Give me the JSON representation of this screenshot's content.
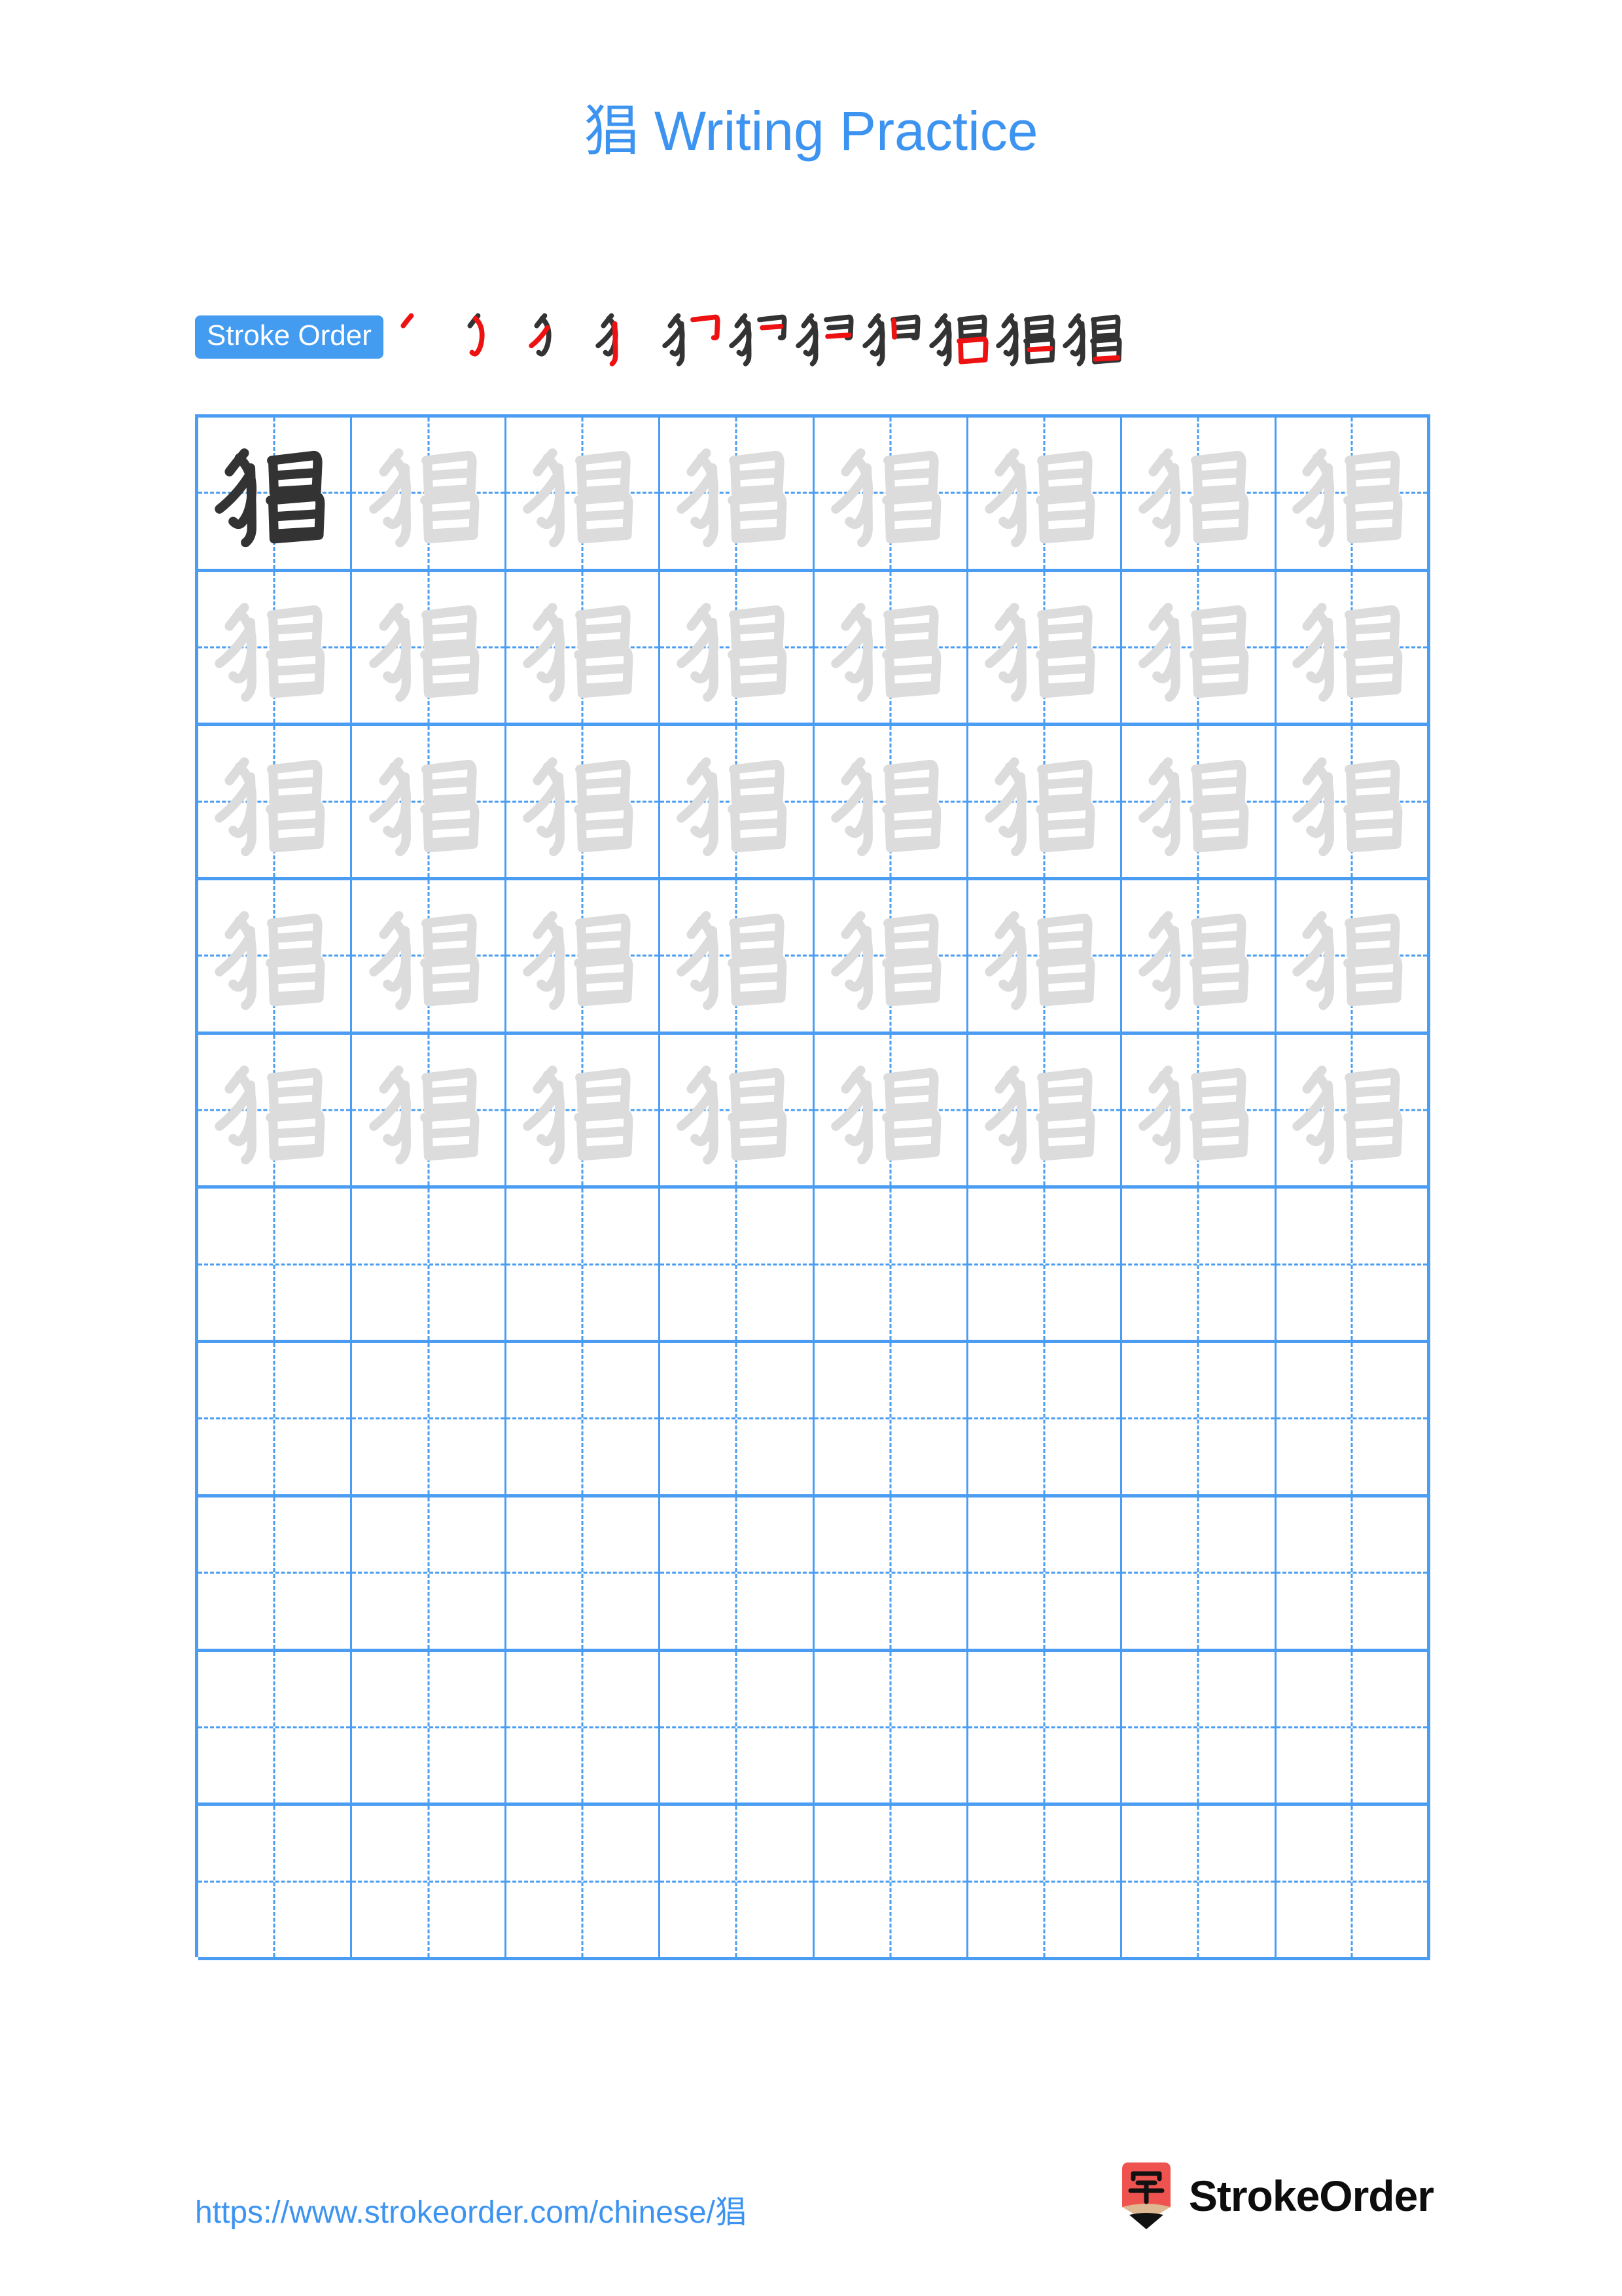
{
  "document": {
    "character": "猖",
    "title_suffix": " Writing Practice",
    "title_full": "猖 Writing Practice",
    "page_background": "#ffffff"
  },
  "colors": {
    "accent_blue": "#4a9df2",
    "title_blue": "#3d94f0",
    "badge_blue": "#449cf0",
    "grid_line": "#4a9df2",
    "trace_gray": "#dcdcdc",
    "ink_dark": "#333333",
    "new_stroke_red": "#ee1111",
    "logo_red": "#ef5350",
    "logo_wood": "#ddb892",
    "logo_text": "#0d0d0d"
  },
  "stroke_order": {
    "badge_label": "Stroke Order",
    "total_strokes": 11,
    "steps": [
      {
        "index": 1,
        "name": "stroke-step-1",
        "new_stroke": "piě"
      },
      {
        "index": 2,
        "name": "stroke-step-2",
        "new_stroke": "wān-gōu"
      },
      {
        "index": 3,
        "name": "stroke-step-3",
        "new_stroke": "piě"
      },
      {
        "index": 4,
        "name": "stroke-step-4",
        "new_stroke": "shù"
      },
      {
        "index": 5,
        "name": "stroke-step-5",
        "new_stroke": "héng-zhé-gōu"
      },
      {
        "index": 6,
        "name": "stroke-step-6",
        "new_stroke": "héng"
      },
      {
        "index": 7,
        "name": "stroke-step-7",
        "new_stroke": "héng"
      },
      {
        "index": 8,
        "name": "stroke-step-8",
        "new_stroke": "shù"
      },
      {
        "index": 9,
        "name": "stroke-step-9",
        "new_stroke": "héng-zhé"
      },
      {
        "index": 10,
        "name": "stroke-step-10",
        "new_stroke": "héng"
      },
      {
        "index": 11,
        "name": "stroke-step-11",
        "new_stroke": "héng"
      }
    ]
  },
  "practice_grid": {
    "columns": 8,
    "rows": 10,
    "filled_rows": 5,
    "empty_rows": 5,
    "first_cell_is_model": true,
    "cell_character": "猖"
  },
  "footer": {
    "url_prefix": "https://www.strokeorder.com/chinese/",
    "url_character": "猖",
    "url_full": "https://www.strokeorder.com/chinese/猖",
    "logo_glyph": "字",
    "logo_text": "StrokeOrder"
  }
}
